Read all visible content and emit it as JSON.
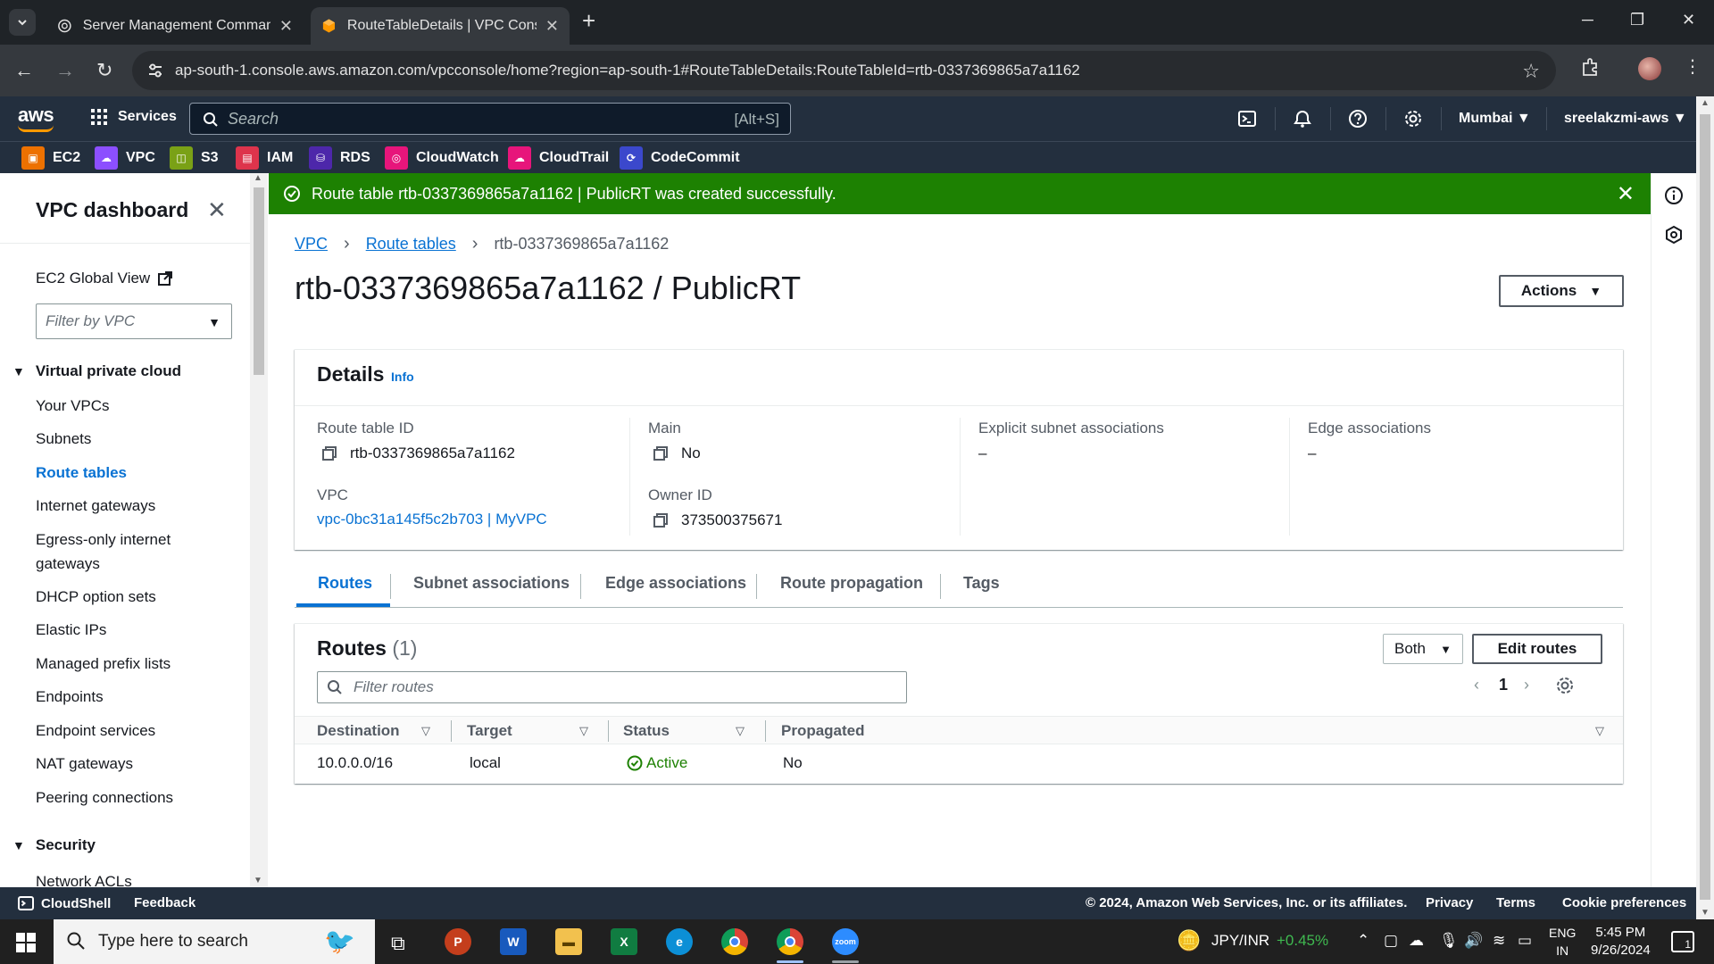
{
  "browser": {
    "tabs": [
      {
        "title": "Server Management Command",
        "close": "✕"
      },
      {
        "title": "RouteTableDetails | VPC Consol",
        "close": "✕"
      }
    ],
    "new_tab": "+",
    "address": "ap-south-1.console.aws.amazon.com/vpcconsole/home?region=ap-south-1#RouteTableDetails:RouteTableId=rtb-0337369865a7a1162"
  },
  "aws_header": {
    "logo": "aws",
    "services_label": "Services",
    "search_placeholder": "Search",
    "search_hint": "[Alt+S]",
    "region": "Mumbai ▼",
    "account": "sreelakzmi-aws ▼",
    "favorites": [
      {
        "label": "EC2",
        "color": "#ed7100",
        "icon": "ec2-icon"
      },
      {
        "label": "VPC",
        "color": "#8c4fff",
        "icon": "vpc-icon"
      },
      {
        "label": "S3",
        "color": "#7aa116",
        "icon": "s3-icon"
      },
      {
        "label": "IAM",
        "color": "#dd344c",
        "icon": "iam-icon"
      },
      {
        "label": "RDS",
        "color": "#4d27aa",
        "icon": "rds-icon"
      },
      {
        "label": "CloudWatch",
        "color": "#e7157b",
        "icon": "cloudwatch-icon"
      },
      {
        "label": "CloudTrail",
        "color": "#e7157b",
        "icon": "cloudtrail-icon"
      },
      {
        "label": "CodeCommit",
        "color": "#3b48cc",
        "icon": "codecommit-icon"
      }
    ]
  },
  "flash": {
    "message": "Route table rtb-0337369865a7a1162 | PublicRT was created successfully.",
    "color": "#1d8102"
  },
  "sidebar": {
    "title": "VPC dashboard",
    "global_view": "EC2 Global View",
    "filter_placeholder": "Filter by VPC",
    "sections": [
      {
        "label": "Virtual private cloud"
      },
      {
        "label": "Security"
      }
    ],
    "items": [
      {
        "label": "Your VPCs"
      },
      {
        "label": "Subnets"
      },
      {
        "label": "Route tables"
      },
      {
        "label": "Internet gateways"
      },
      {
        "label": "Egress-only internet gateways"
      },
      {
        "label": "DHCP option sets"
      },
      {
        "label": "Elastic IPs"
      },
      {
        "label": "Managed prefix lists"
      },
      {
        "label": "Endpoints"
      },
      {
        "label": "Endpoint services"
      },
      {
        "label": "NAT gateways"
      },
      {
        "label": "Peering connections"
      },
      {
        "label": "Network ACLs"
      }
    ],
    "active_item": "Route tables"
  },
  "breadcrumb": {
    "items": [
      "VPC",
      "Route tables",
      "rtb-0337369865a7a1162"
    ]
  },
  "page": {
    "title": "rtb-0337369865a7a1162 / PublicRT",
    "actions_label": "Actions"
  },
  "details": {
    "heading": "Details",
    "info": "Info",
    "route_table_id_label": "Route table ID",
    "route_table_id": "rtb-0337369865a7a1162",
    "vpc_label": "VPC",
    "vpc_value": "vpc-0bc31a145f5c2b703 | MyVPC",
    "main_label": "Main",
    "main_value": "No",
    "owner_label": "Owner ID",
    "owner_value": "373500375671",
    "explicit_label": "Explicit subnet associations",
    "explicit_value": "–",
    "edge_label": "Edge associations",
    "edge_value": "–"
  },
  "tabs": [
    {
      "label": "Routes",
      "active": true
    },
    {
      "label": "Subnet associations"
    },
    {
      "label": "Edge associations"
    },
    {
      "label": "Route propagation"
    },
    {
      "label": "Tags"
    }
  ],
  "routes": {
    "heading": "Routes",
    "count": "(1)",
    "both_label": "Both",
    "edit_label": "Edit routes",
    "filter_placeholder": "Filter routes",
    "page": "1",
    "columns": [
      "Destination",
      "Target",
      "Status",
      "Propagated"
    ],
    "rows": [
      {
        "destination": "10.0.0.0/16",
        "target": "local",
        "status": "Active",
        "propagated": "No"
      }
    ]
  },
  "footer": {
    "cloudshell": "CloudShell",
    "feedback": "Feedback",
    "copyright": "© 2024, Amazon Web Services, Inc. or its affiliates.",
    "privacy": "Privacy",
    "terms": "Terms",
    "cookies": "Cookie preferences"
  },
  "taskbar": {
    "search_placeholder": "Type here to search",
    "currency": "JPY/INR",
    "currency_change": "+0.45%",
    "lang_line1": "ENG",
    "lang_line2": "IN",
    "time": "5:45 PM",
    "date": "9/26/2024",
    "notifications": "1"
  }
}
